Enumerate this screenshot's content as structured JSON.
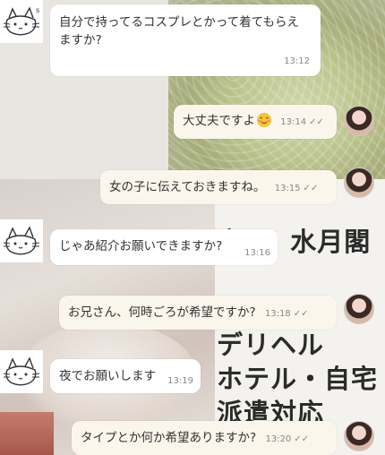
{
  "background": {
    "ad_lines": [
      "高 ・ 水月閣",
      "",
      "デリヘル",
      "ホテル・自宅",
      "派遣対応"
    ]
  },
  "messages": [
    {
      "side": "left",
      "lines": [
        "自分で持ってるコスプレとかって着てもらえ",
        "ますか?"
      ],
      "time": "13:12"
    },
    {
      "side": "right",
      "text": "大丈夫ですよ",
      "emoji": "smiling-face",
      "time": "13:14"
    },
    {
      "side": "right",
      "text": "女の子に伝えておきますね。",
      "time": "13:15"
    },
    {
      "side": "left",
      "text": "じゃあ紹介お願いできますか?",
      "time": "13:16"
    },
    {
      "side": "right",
      "text": "お兄さん、何時ごろが希望ですか?",
      "time": "13:18"
    },
    {
      "side": "left",
      "text": "夜でお願いします",
      "time": "13:19"
    },
    {
      "side": "right",
      "text": "タイプとか何か希望ありますか?",
      "time": "13:20"
    }
  ],
  "read_mark": "✓✓",
  "colors": {
    "left_bubble": "#ffffff",
    "right_bubble": "#fbf6ec",
    "time_text": "#888888"
  },
  "icons": {
    "shop_avatar": "cat-doodle-icon",
    "girl_avatar": "profile-photo"
  }
}
